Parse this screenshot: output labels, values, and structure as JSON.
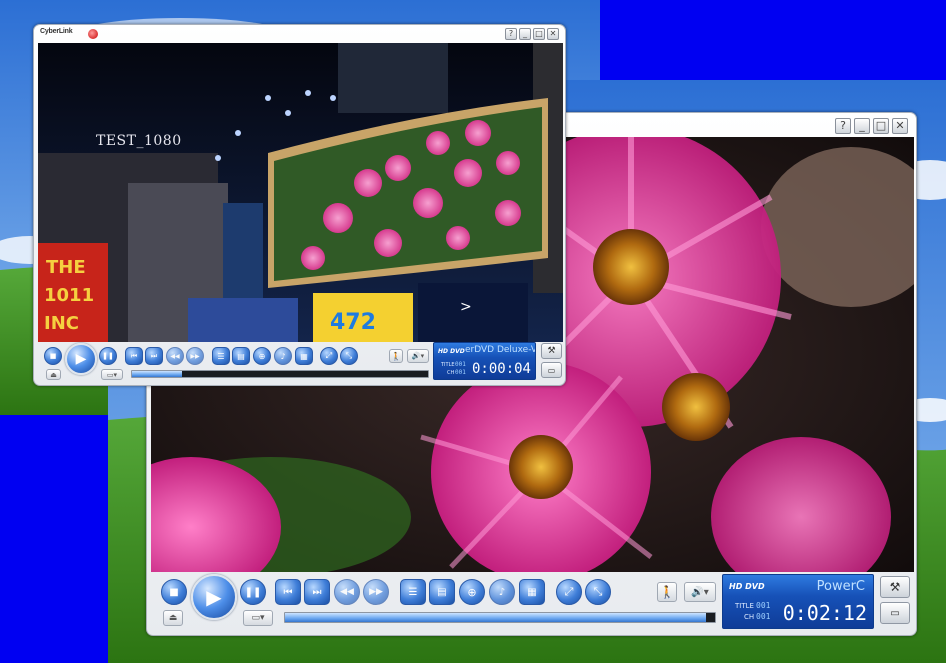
{
  "colors": {
    "desktop_blue": "#0000f2",
    "sky": "#3c8be0",
    "grass": "#3f8f22",
    "accent_blue": "#1651b7",
    "flower_pink": "#e0369a"
  },
  "front_player": {
    "brand": "CyberLink",
    "window_buttons": [
      "?",
      "_",
      "□",
      "✕"
    ],
    "watermark": "TEST_1080",
    "scene": {
      "sign_left": "THE 1011 INC",
      "sign_number": "472"
    },
    "lcd": {
      "logo": "HD DVD",
      "title_text": "erDVD Deluxe-V",
      "title_label": "TITLE",
      "title_value": "001",
      "chapter_label": "CH",
      "chapter_value": "001",
      "time": "0:00:04"
    },
    "progress": 0.17,
    "icons": [
      "stop-icon",
      "play-icon",
      "pause-icon",
      "previous-icon",
      "next-icon",
      "rewind-icon",
      "fast-forward-icon",
      "menu-icon",
      "subtitle-icon",
      "angle-icon",
      "audio-icon",
      "playlist-icon",
      "zoom-in-icon",
      "zoom-out-icon",
      "eject-icon",
      "volume-icon",
      "settings-icon",
      "expand-icon"
    ]
  },
  "back_player": {
    "window_buttons": [
      "?",
      "_",
      "□",
      "✕"
    ],
    "lcd": {
      "logo": "HD DVD",
      "title_text": "PowerC",
      "title_label": "TITLE",
      "title_value": "001",
      "chapter_label": "CH",
      "chapter_value": "001",
      "time": "0:02:12"
    },
    "progress": 0.98
  }
}
